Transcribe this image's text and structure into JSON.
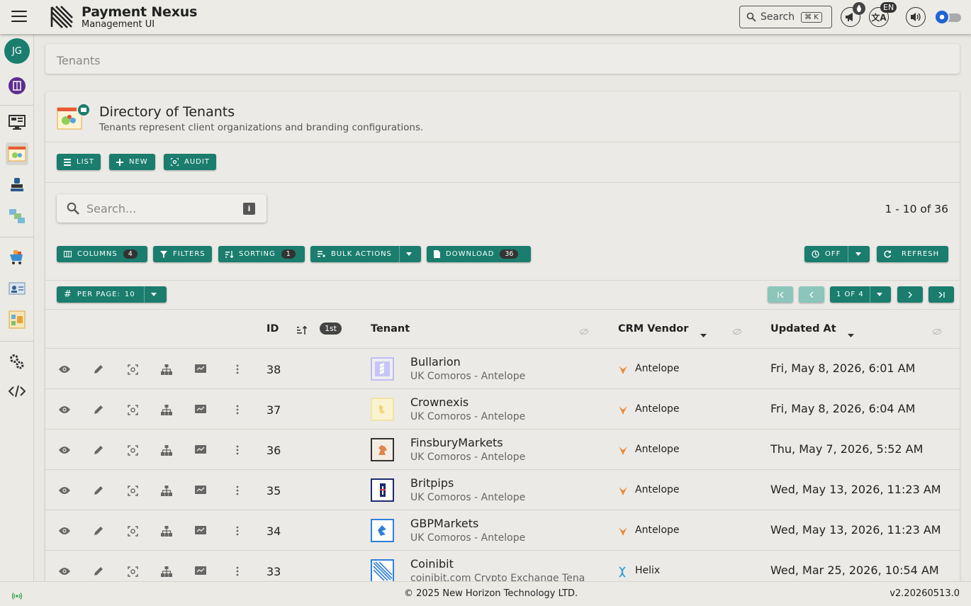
{
  "app": {
    "brand_title": "Payment Nexus",
    "brand_subtitle": "Management UI"
  },
  "topbar": {
    "search_label": "Search",
    "search_shortcut": "⌘ K",
    "language_badge": "EN",
    "icons": [
      "menu-icon",
      "megaphone-icon",
      "translate-icon",
      "volume-icon",
      "theme-toggle"
    ]
  },
  "sidebar": {
    "avatar_initials": "JG",
    "items": [
      "workspace-icon",
      "dashboard-icon",
      "tenants-icon",
      "stamp-icon",
      "modules-icon",
      "shop-icon",
      "contact-card-icon",
      "report-icon",
      "settings-icon",
      "code-icon"
    ]
  },
  "breadcrumb": {
    "label": "Tenants"
  },
  "page": {
    "title": "Directory of Tenants",
    "subtitle": "Tenants represent client organizations and branding configurations.",
    "actions": {
      "list": "LIST",
      "new": "NEW",
      "audit": "AUDIT"
    }
  },
  "search": {
    "placeholder": "Search...",
    "info": "i"
  },
  "pagination": {
    "range": "1 - 10 of 36",
    "page_of": "1 OF 4",
    "per_page_label": "PER PAGE:",
    "per_page_value": "10"
  },
  "toolbar": {
    "columns": "COLUMNS",
    "columns_count": "4",
    "filters": "FILTERS",
    "sorting": "SORTING",
    "sorting_count": "1",
    "bulk": "BULK ACTIONS",
    "download": "DOWNLOAD",
    "download_count": "36",
    "autorefresh": "OFF",
    "refresh": "REFRESH"
  },
  "table": {
    "headers": {
      "id": "ID",
      "sort_badge": "1st",
      "tenant": "Tenant",
      "crm": "CRM Vendor",
      "updated": "Updated At"
    },
    "rows": [
      {
        "id": "38",
        "name": "Bullarion",
        "sub": "UK Comoros - Antelope",
        "vendor": "Antelope",
        "updated": "Fri, May 8, 2026, 6:01 AM"
      },
      {
        "id": "37",
        "name": "Crownexis",
        "sub": "UK Comoros - Antelope",
        "vendor": "Antelope",
        "updated": "Fri, May 8, 2026, 6:04 AM"
      },
      {
        "id": "36",
        "name": "FinsburyMarkets",
        "sub": "UK Comoros - Antelope",
        "vendor": "Antelope",
        "updated": "Thu, May 7, 2026, 5:52 AM"
      },
      {
        "id": "35",
        "name": "Britpips",
        "sub": "UK Comoros - Antelope",
        "vendor": "Antelope",
        "updated": "Wed, May 13, 2026, 11:23 AM"
      },
      {
        "id": "34",
        "name": "GBPMarkets",
        "sub": "UK Comoros - Antelope",
        "vendor": "Antelope",
        "updated": "Wed, May 13, 2026, 11:23 AM"
      },
      {
        "id": "33",
        "name": "Coinibit",
        "sub": "coinibit.com Crypto Exchange Tena",
        "vendor": "Helix",
        "updated": "Wed, Mar 25, 2026, 10:54 AM"
      }
    ]
  },
  "footer": {
    "copyright": "© 2025 New Horizon Technology LTD.",
    "version": "v2.20260513.0"
  },
  "colors": {
    "accent": "#1a7d6e",
    "toggle": "#1d63d6"
  }
}
